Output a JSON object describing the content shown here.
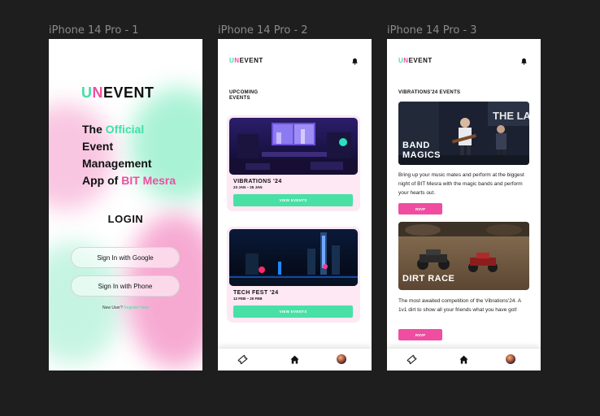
{
  "frames": {
    "f1_title": "iPhone 14 Pro - 1",
    "f2_title": "iPhone 14 Pro - 2",
    "f3_title": "iPhone 14 Pro - 3"
  },
  "brand": {
    "u": "U",
    "n": "N",
    "rest": "EVENT"
  },
  "screen1": {
    "tag1": "The ",
    "tag2": "Official",
    "tag3": "Event",
    "tag4": "Management",
    "tag5": "App of ",
    "tag6": "BIT Mesra",
    "login_heading": "LOGIN",
    "google_button": "Sign In with Google",
    "phone_button": "Sign In with Phone",
    "new_user": "New User? ",
    "register_link": "Register Here"
  },
  "screen2": {
    "section_line1": "UPCOMING",
    "section_line2": "EVENTS",
    "events": [
      {
        "name": "VIBRATIONS '24",
        "dates": "23 JAN – 25 JAN",
        "button": "VIEW EVENTS"
      },
      {
        "name": "TECH FEST '24",
        "dates": "12 FEB – 20 FEB",
        "button": "VIEW EVENTS"
      }
    ]
  },
  "screen3": {
    "section": "VIBRATIONS'24 EVENTS",
    "events": [
      {
        "label1": "BAND",
        "label2": "MAGICS",
        "description": "Bring up your music mates and perform at the biggest night of BIT Mesra with the magic bands and perform your hearts out.",
        "button": "RSVP",
        "backdrop_text": "THE LA  TO"
      },
      {
        "label1": "DIRT RACE",
        "description": "The most awaited competition of the Vibrations'24. A 1v1 dirt to show all your friends what you have got!",
        "button": "RSVP"
      }
    ]
  },
  "nav": {
    "icons": [
      "ticket-icon",
      "home-icon",
      "avatar"
    ]
  },
  "colors": {
    "mint": "#3fe0a6",
    "pink": "#f04da0",
    "button_green": "#48e0a5",
    "card_pink": "#fde8f3",
    "canvas": "#1e1e1e"
  }
}
